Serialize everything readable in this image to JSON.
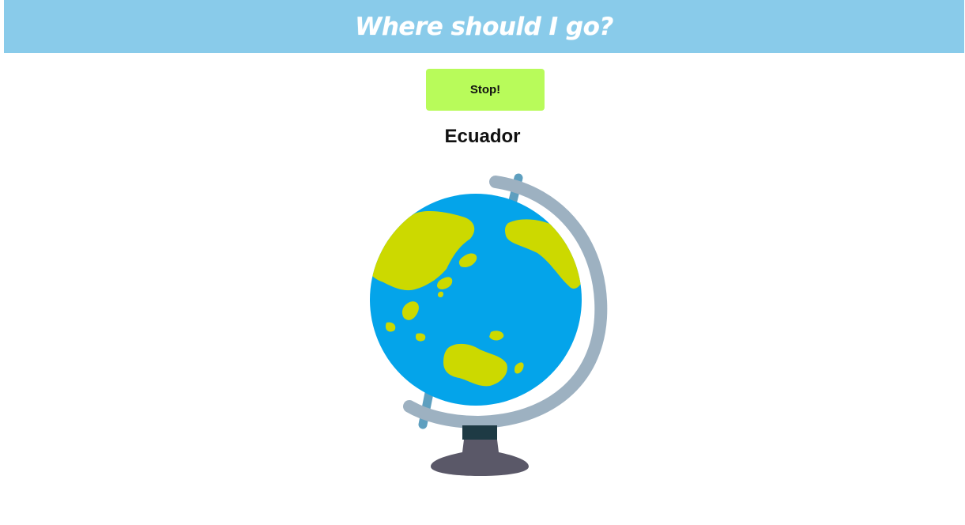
{
  "header": {
    "title": "Where should I go?",
    "background_color": "#89cbea"
  },
  "controls": {
    "stop_label": "Stop!",
    "button_color": "#b8fb5a"
  },
  "result": {
    "country": "Ecuador"
  },
  "illustration": {
    "icon": "globe-icon",
    "ocean_color": "#04a4ea",
    "land_color": "#ccd900",
    "frame_color": "#9db1c1",
    "base_color": "#5a5868"
  }
}
